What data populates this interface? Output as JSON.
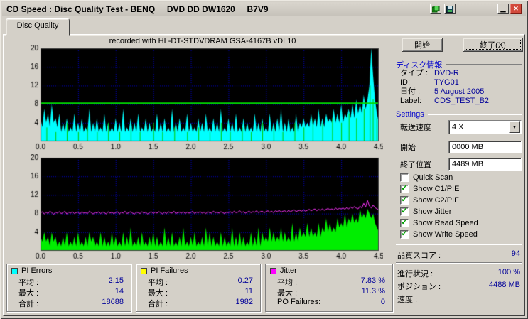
{
  "window": {
    "title": "CD Speed : Disc Quality Test - BENQ     DVD DD DW1620     B7V9"
  },
  "icons": {
    "minimize": "▁",
    "close": "✕",
    "combo_arrow": "▼",
    "check": "✓"
  },
  "tab": {
    "label": "Disc Quality"
  },
  "chart_header": "recorded with HL-DT-STDVDRAM GSA-4167B vDL10",
  "buttons": {
    "start": "開始",
    "exit": "終了(X)"
  },
  "colors": {
    "window_bg": "#d4d0c8",
    "section_header": "#0000cc",
    "value_text": "#000099",
    "check": "#00a000"
  },
  "disc_info": {
    "title": "ディスク情報",
    "rows": [
      {
        "label": "タイプ :",
        "value": "DVD-R"
      },
      {
        "label": "ID:",
        "value": "TYG01"
      },
      {
        "label": "日付 :",
        "value": "5 August 2005"
      },
      {
        "label": "Label:",
        "value": "CDS_TEST_B2"
      }
    ]
  },
  "settings": {
    "title": "Settings",
    "speed_label": "転送速度",
    "speed_value": "4 X",
    "start_label": "開始",
    "start_value": "0000 MB",
    "end_label": "終了位置",
    "end_value": "4489 MB",
    "checkboxes": [
      {
        "label": "Quick Scan",
        "checked": false
      },
      {
        "label": "Show C1/PIE",
        "checked": true
      },
      {
        "label": "Show C2/PIF",
        "checked": true
      },
      {
        "label": "Show Jitter",
        "checked": true
      },
      {
        "label": "Show Read Speed",
        "checked": true
      },
      {
        "label": "Show Write Speed",
        "checked": true
      }
    ]
  },
  "status": {
    "score_label": "品質スコア :",
    "score_value": "94",
    "progress_label": "進行状況 :",
    "progress_value": "100 %",
    "position_label": "ポジション :",
    "position_value": "4488 MB",
    "speed_label": "速度 :",
    "speed_value": ""
  },
  "stats_panels": [
    {
      "title": "PI Errors",
      "color": "#00ffff",
      "rows": [
        {
          "label": "平均 :",
          "value": "2.15"
        },
        {
          "label": "最大 :",
          "value": "14"
        },
        {
          "label": "合計 :",
          "value": "18688"
        }
      ]
    },
    {
      "title": "PI Failures",
      "color": "#ffff00",
      "rows": [
        {
          "label": "平均 :",
          "value": "0.27"
        },
        {
          "label": "最大 :",
          "value": "11"
        },
        {
          "label": "合計 :",
          "value": "1982"
        }
      ]
    },
    {
      "title": "Jitter",
      "color": "#ff00ff",
      "rows": [
        {
          "label": "平均 :",
          "value": "7.83 %"
        },
        {
          "label": "最大 :",
          "value": "11.3 %"
        },
        {
          "label": "PO Failures:",
          "value": "0"
        }
      ]
    }
  ],
  "chart_data": [
    {
      "type": "area",
      "name": "pi-errors-scan",
      "title": "PI Errors (C1/PIE) vs position (GB)",
      "xlim": [
        0,
        4.5
      ],
      "ylim": [
        0,
        20
      ],
      "x_ticks": [
        "0.0",
        "0.5",
        "1.0",
        "1.5",
        "2.0",
        "2.5",
        "3.0",
        "3.5",
        "4.0",
        "4.5"
      ],
      "y_ticks": [
        20,
        16,
        12,
        8,
        4
      ],
      "grid": true,
      "grid_color": "#0000cc",
      "series": [
        {
          "name": "PI Errors",
          "style": "area",
          "color": "#00ffff",
          "values": [
            5,
            3,
            7,
            4,
            6,
            3,
            8,
            4,
            5,
            3,
            6,
            2,
            4,
            2,
            5,
            2,
            3,
            2,
            6,
            2,
            4,
            2,
            5,
            2,
            3,
            2,
            7,
            2,
            4,
            2,
            5,
            2,
            3,
            2,
            6,
            2,
            4,
            2,
            3,
            2,
            5,
            2,
            4,
            2,
            7,
            2,
            3,
            2,
            5,
            2,
            4,
            2,
            6,
            2,
            3,
            2,
            5,
            2,
            4,
            2,
            3,
            2,
            6,
            2,
            4,
            2,
            5,
            2,
            3,
            2,
            7,
            2,
            4,
            2,
            5,
            2,
            3,
            2,
            6,
            2,
            4,
            2,
            3,
            2,
            5,
            2,
            4,
            2,
            6,
            2,
            3,
            2,
            5,
            2,
            4,
            2,
            7,
            2,
            3,
            2,
            5,
            2,
            4,
            2,
            6,
            2,
            3,
            2,
            5,
            2,
            4,
            2,
            3,
            2,
            6,
            2,
            4,
            2,
            5,
            2,
            3,
            2,
            6,
            2,
            4,
            2,
            5,
            2,
            7,
            2,
            4,
            2,
            5,
            2,
            3,
            2,
            6,
            2,
            4,
            3,
            5,
            3,
            4,
            3,
            6,
            3,
            5,
            3,
            7,
            3,
            5,
            3,
            6,
            4,
            5,
            4,
            7,
            4,
            6,
            4,
            8,
            4,
            6,
            5,
            7,
            5,
            8,
            5,
            9,
            6,
            8,
            6,
            10,
            7,
            9,
            12,
            20,
            14,
            9,
            6,
            4
          ]
        },
        {
          "name": "Write Speed spikes",
          "style": "spikes",
          "color": "#00cc00",
          "points": [
            [
              0.08,
              3
            ],
            [
              0.2,
              2
            ],
            [
              0.35,
              4
            ],
            [
              0.5,
              2
            ],
            [
              0.62,
              3
            ],
            [
              0.75,
              2
            ],
            [
              0.9,
              4
            ],
            [
              1.05,
              2
            ],
            [
              1.2,
              3
            ],
            [
              1.32,
              2
            ],
            [
              1.5,
              4
            ],
            [
              1.62,
              2
            ],
            [
              1.78,
              3
            ],
            [
              1.95,
              2
            ],
            [
              2.1,
              3
            ],
            [
              2.25,
              2
            ],
            [
              2.4,
              4
            ],
            [
              2.52,
              2
            ],
            [
              2.68,
              3
            ],
            [
              2.8,
              2
            ],
            [
              2.95,
              4
            ],
            [
              3.1,
              3
            ],
            [
              3.22,
              2
            ],
            [
              3.38,
              4
            ],
            [
              3.5,
              3
            ],
            [
              3.62,
              5
            ],
            [
              3.75,
              4
            ],
            [
              3.88,
              5
            ],
            [
              4.0,
              4
            ],
            [
              4.1,
              6
            ],
            [
              4.2,
              5
            ],
            [
              4.3,
              7
            ],
            [
              4.38,
              12
            ],
            [
              4.42,
              9
            ],
            [
              4.47,
              5
            ]
          ]
        },
        {
          "name": "Speed line 4x",
          "style": "hline",
          "color": "#00dd00",
          "width": 2,
          "y": 8.3
        }
      ]
    },
    {
      "type": "line",
      "name": "pif-jitter-scan",
      "title": "PI Failures / Jitter / Write Speed vs position (GB)",
      "xlim": [
        0,
        4.5
      ],
      "ylim": [
        0,
        20
      ],
      "x_ticks": [
        "0.0",
        "0.5",
        "1.0",
        "1.5",
        "2.0",
        "2.5",
        "3.0",
        "3.5",
        "4.0",
        "4.5"
      ],
      "y_ticks": [
        20,
        16,
        12,
        8,
        4
      ],
      "grid": true,
      "grid_color": "#0000cc",
      "series": [
        {
          "name": "PI Failures",
          "style": "spikes",
          "color": "#ffff00",
          "points": [
            [
              0.3,
              1
            ],
            [
              0.8,
              1
            ],
            [
              1.4,
              1
            ],
            [
              1.9,
              1
            ],
            [
              2.3,
              1
            ],
            [
              2.8,
              1
            ],
            [
              3.3,
              1
            ],
            [
              3.8,
              1
            ],
            [
              4.1,
              1.5
            ],
            [
              4.35,
              2
            ]
          ]
        },
        {
          "name": "Write Speed",
          "style": "area",
          "color": "#00ee00",
          "values": [
            3,
            2,
            4,
            2,
            3,
            1,
            4,
            2,
            3,
            1,
            2,
            1,
            3,
            1,
            4,
            1,
            2,
            1,
            3,
            1,
            4,
            1,
            2,
            1,
            3,
            1,
            4,
            2,
            3,
            1,
            2,
            1,
            4,
            1,
            3,
            1,
            2,
            1,
            4,
            1,
            3,
            1,
            2,
            1,
            4,
            1,
            3,
            1,
            5,
            1,
            2,
            1,
            3,
            1,
            4,
            1,
            2,
            1,
            3,
            1,
            4,
            1,
            3,
            1,
            2,
            1,
            5,
            1,
            3,
            1,
            4,
            1,
            2,
            1,
            3,
            1,
            5,
            1,
            2,
            1,
            3,
            1,
            4,
            1,
            2,
            1,
            3,
            1,
            5,
            1,
            4,
            1,
            3,
            1,
            2,
            1,
            4,
            1,
            3,
            1,
            2,
            1,
            5,
            1,
            3,
            1,
            4,
            1,
            3,
            1,
            2,
            1,
            4,
            1,
            3,
            1,
            5,
            1,
            4,
            2,
            3,
            2,
            5,
            2,
            4,
            2,
            3,
            2,
            5,
            2,
            4,
            2,
            3,
            2,
            6,
            2,
            4,
            2,
            5,
            3,
            4,
            3,
            6,
            3,
            5,
            3,
            4,
            3,
            6,
            3,
            5,
            4,
            7,
            4,
            6,
            4,
            5,
            4,
            7,
            5,
            6,
            5,
            8,
            5,
            7,
            6,
            8,
            6,
            7,
            6,
            9,
            7,
            8,
            7,
            9,
            8,
            7,
            8,
            6,
            5,
            4
          ]
        },
        {
          "name": "Jitter",
          "style": "line",
          "color": "#ff33ff",
          "values": [
            8.1,
            8.4,
            7.9,
            8.3,
            8.0,
            8.5,
            8.2,
            7.8,
            8.3,
            8.1,
            8.4,
            8.0,
            8.2,
            8.5,
            7.9,
            8.3,
            8.1,
            8.4,
            8.0,
            8.2,
            8.3,
            7.9,
            8.4,
            8.1,
            8.2,
            8.0,
            8.5,
            8.2,
            7.9,
            8.3,
            8.1,
            8.4,
            8.0,
            8.3,
            8.2,
            7.9,
            8.4,
            8.1,
            8.3,
            8.0,
            8.2,
            8.4,
            7.9,
            8.3,
            8.1,
            8.5,
            8.0,
            8.2,
            8.4,
            8.1,
            7.9,
            8.3,
            8.2,
            8.0,
            8.4,
            8.1,
            8.3,
            7.9,
            8.2,
            8.4,
            8.0,
            8.3,
            8.1,
            8.4,
            8.2,
            7.9,
            8.3,
            8.0,
            8.4,
            8.2,
            8.1,
            8.5,
            8.0,
            8.2,
            8.3,
            8.1,
            8.4,
            8.0,
            8.3,
            8.1,
            8.2,
            8.5,
            8.0,
            8.3,
            8.2,
            8.4,
            8.1,
            8.3,
            8.0,
            8.4,
            8.2,
            8.1,
            8.5,
            8.2,
            8.3,
            8.1,
            8.4,
            8.2,
            8.0,
            8.3,
            8.2,
            8.4,
            8.1,
            8.5,
            8.2,
            8.3,
            8.6,
            8.2,
            8.4,
            8.1,
            8.3,
            8.5,
            8.2,
            8.4,
            8.3,
            8.6,
            8.2,
            8.4,
            8.5,
            8.2,
            8.4,
            8.6,
            8.3,
            8.5,
            8.2,
            8.6,
            8.4,
            8.7,
            8.3,
            8.5,
            8.6,
            8.3,
            8.7,
            8.4,
            8.6,
            8.8,
            8.4,
            8.6,
            8.7,
            8.5,
            8.8,
            8.5,
            8.7,
            8.9,
            8.6,
            8.8,
            9.0,
            8.6,
            8.9,
            8.7,
            9.0,
            8.7,
            8.9,
            9.1,
            8.8,
            9.0,
            8.8,
            9.2,
            8.9,
            9.1,
            9.0,
            9.2,
            8.9,
            9.3,
            9.0,
            9.4,
            9.1,
            9.5,
            9.2,
            9.0,
            9.6,
            9.2,
            10.2,
            9.4,
            10.8,
            9.6,
            9.2,
            9.8,
            9.3,
            9.0,
            8.8
          ]
        }
      ]
    }
  ]
}
